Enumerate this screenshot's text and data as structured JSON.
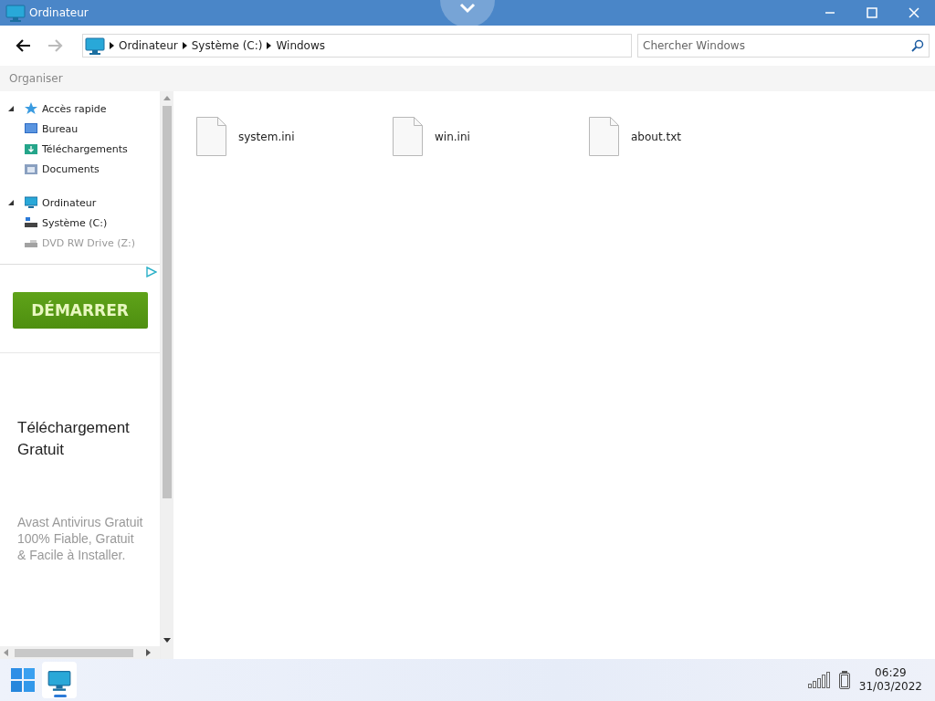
{
  "window": {
    "title": "Ordinateur"
  },
  "address": {
    "crumbs": [
      "Ordinateur",
      "Système (C:)",
      "Windows"
    ]
  },
  "search": {
    "placeholder": "Chercher Windows"
  },
  "toolbar": {
    "organize": "Organiser"
  },
  "sidebar": {
    "groups": [
      {
        "label": "Accès rapide",
        "expanded": true,
        "children": [
          {
            "label": "Bureau",
            "disabled": false
          },
          {
            "label": "Téléchargements",
            "disabled": false
          },
          {
            "label": "Documents",
            "disabled": false
          }
        ]
      },
      {
        "label": "Ordinateur",
        "expanded": true,
        "children": [
          {
            "label": "Système (C:)",
            "disabled": false
          },
          {
            "label": "DVD RW Drive (Z:)",
            "disabled": true
          }
        ]
      }
    ]
  },
  "ad": {
    "button": "DÉMARRER",
    "heading": "Téléchargement Gratuit",
    "text": "Avast Antivirus Gratuit 100% Fiable, Gratuit & Facile à Installer."
  },
  "files": [
    {
      "name": "system.ini"
    },
    {
      "name": "win.ini"
    },
    {
      "name": "about.txt"
    }
  ],
  "taskbar": {
    "apps": [
      {
        "kind": "start",
        "selected": false
      },
      {
        "kind": "explorer",
        "selected": true
      }
    ],
    "time": "06:29",
    "date": "31/03/2022"
  }
}
